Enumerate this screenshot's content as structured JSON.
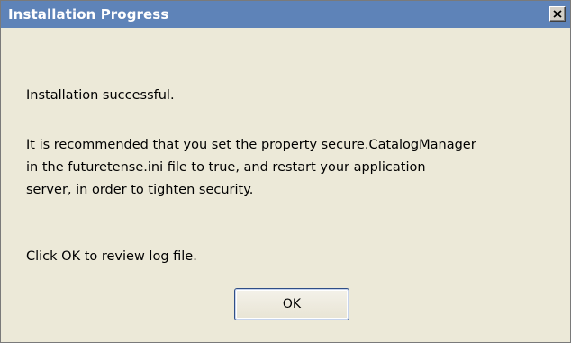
{
  "window": {
    "title": "Installation Progress",
    "close_label": "×"
  },
  "message": {
    "status": "Installation successful.",
    "recommendation_line1": "It is recommended that you set the property secure.CatalogManager",
    "recommendation_line2": "in the futuretense.ini file to true, and restart your application",
    "recommendation_line3": "server, in order to tighten security.",
    "instruction": "Click OK to review log file."
  },
  "buttons": {
    "ok_label": "OK"
  },
  "colors": {
    "titlebar": "#5e83b8",
    "background": "#ece9d8",
    "button_border": "#2f4e86"
  }
}
